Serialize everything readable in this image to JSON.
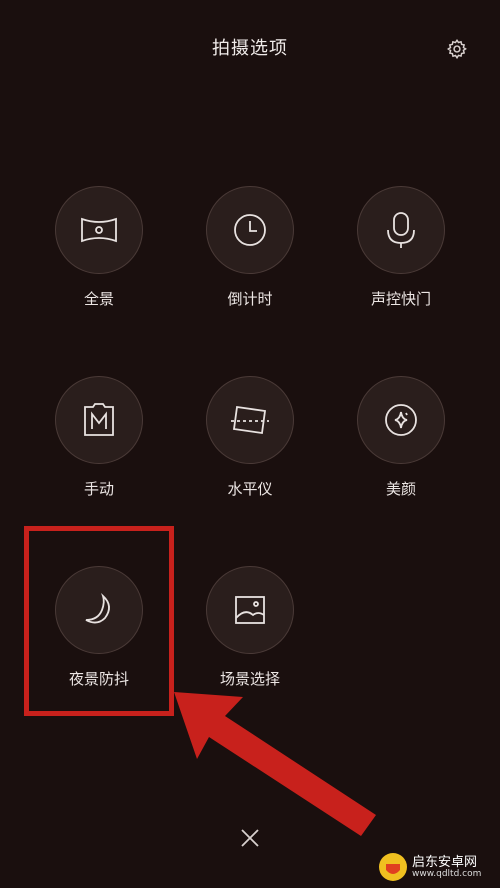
{
  "header": {
    "title": "拍摄选项"
  },
  "icons": {
    "settings": "gear-icon",
    "close": "close-icon"
  },
  "modes": [
    {
      "label": "全景",
      "icon": "panorama-icon"
    },
    {
      "label": "倒计时",
      "icon": "clock-icon"
    },
    {
      "label": "声控快门",
      "icon": "microphone-icon"
    },
    {
      "label": "手动",
      "icon": "manual-m-icon"
    },
    {
      "label": "水平仪",
      "icon": "level-icon"
    },
    {
      "label": "美颜",
      "icon": "sparkle-icon"
    },
    {
      "label": "夜景防抖",
      "icon": "moon-icon"
    },
    {
      "label": "场景选择",
      "icon": "landscape-icon"
    }
  ],
  "watermark": {
    "brand": "启东安卓网",
    "url": "www.qdltd.com"
  },
  "colors": {
    "background": "#1a0f0e",
    "highlight": "#c8211c"
  }
}
